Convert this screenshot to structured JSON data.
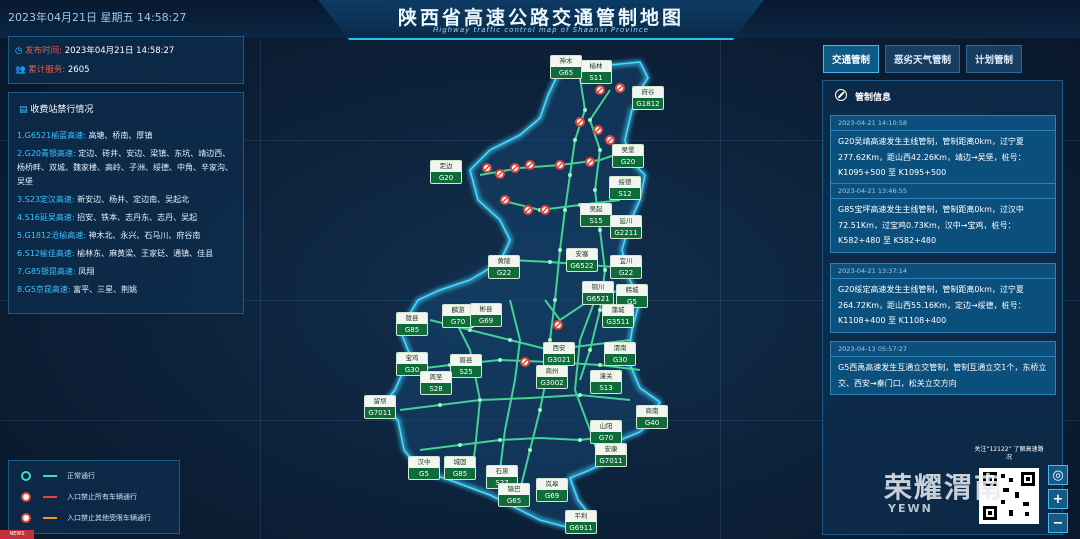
{
  "header": {
    "datetime": "2023年04月21日 星期五 14:58:27",
    "title": "陕西省高速公路交通管制地图",
    "subtitle": "Highway traffic control map of Shaanxi Province"
  },
  "info": {
    "publish_label": "发布时间:",
    "publish_value": "2023年04月21日 14:58:27",
    "served_label": "累计服务:",
    "served_value": "2605"
  },
  "toll": {
    "title": "收费站禁行情况",
    "rows": [
      {
        "road": "1.G6521榆蓝高速:",
        "stations": "高塘、桥南、厚镇"
      },
      {
        "road": "2.G20青银高速:",
        "stations": "定边、砖井、安边、梁镇、东坑、靖边西、杨桥畔、双城、魏家楼、高岭、子洲、绥德、中角、辛家沟、吴堡"
      },
      {
        "road": "3.S23定汉高速:",
        "stations": "新安边、杨井、定边南、吴起北"
      },
      {
        "road": "4.S16延吴高速:",
        "stations": "招安、铁本、志丹东、志丹、吴起"
      },
      {
        "road": "5.G1812沧榆高速:",
        "stations": "神木北、永兴、石马川、府谷南"
      },
      {
        "road": "6.S12榆佳高速:",
        "stations": "榆林东、麻黄梁、王家砭、通镇、佳县"
      },
      {
        "road": "7.G85银昆高速:",
        "stations": "凤翔"
      },
      {
        "road": "8.G5京昆高速:",
        "stations": "富平、三星、荆姚"
      }
    ]
  },
  "legend": [
    {
      "label": "正常通行",
      "icon": "normal-dot-icon",
      "color": "#37e0c0"
    },
    {
      "label": "入口禁止所有车辆通行",
      "icon": "no-entry-icon",
      "color": "#e0453c"
    },
    {
      "label": "入口禁止其他受限车辆通行",
      "icon": "no-entry-icon",
      "color": "#f09a2a"
    }
  ],
  "tabs": [
    "交通管制",
    "恶劣天气管制",
    "计划管制"
  ],
  "control": {
    "title": "管制信息",
    "items": [
      {
        "time": "2023-04-21 14:10:58",
        "text": "G20吴靖高速发生主线管制，管制距离0km，过宁夏277.62Km，距山西42.26Km，靖边→吴堡，桩号：K1095+500 至 K1095+500"
      },
      {
        "time": "2023-04-21 13:46:55",
        "text": "G85宝坪高速发生主线管制，管制距离0km，过汉中72.51Km，过宝鸡0.73Km，汉中→宝鸡，桩号：K582+480 至 K582+480"
      },
      {
        "time": "2023-04-21 13:37:14",
        "text": "G20绥定高速发生主线管制，管制距离0km，过宁夏264.72Km，距山西55.16Km，定边→绥德，桩号：K1108+400 至 K1108+400"
      },
      {
        "time": "2023-04-13 05:57:27",
        "text": "G5西禹高速发生互通立交管制，管制互通立交1个，东桥立交、西安→秦门口，松关立交方向"
      }
    ]
  },
  "shields": [
    {
      "name": "榆林",
      "code": "S11"
    },
    {
      "name": "神木",
      "code": "G65"
    },
    {
      "name": "府谷",
      "code": "G1812"
    },
    {
      "name": "吴堡",
      "code": "G20"
    },
    {
      "name": "绥德",
      "code": "S12"
    },
    {
      "name": "定边",
      "code": "G20"
    },
    {
      "name": "吴起",
      "code": "S15"
    },
    {
      "name": "延川",
      "code": "G2211"
    },
    {
      "name": "安塞",
      "code": "G6522"
    },
    {
      "name": "黄陵",
      "code": "G22"
    },
    {
      "name": "宜川",
      "code": "G22"
    },
    {
      "name": "韩城",
      "code": "G5"
    },
    {
      "name": "铜川",
      "code": "G6521"
    },
    {
      "name": "蒲城",
      "code": "G3511"
    },
    {
      "name": "陇县",
      "code": "G85"
    },
    {
      "name": "麟游",
      "code": "G70"
    },
    {
      "name": "彬县",
      "code": "G69"
    },
    {
      "name": "渭南",
      "code": "G30"
    },
    {
      "name": "西安",
      "code": "G3021"
    },
    {
      "name": "宝鸡",
      "code": "G30"
    },
    {
      "name": "眉县",
      "code": "S25"
    },
    {
      "name": "周至",
      "code": "S28"
    },
    {
      "name": "商州",
      "code": "G3002"
    },
    {
      "name": "潼关",
      "code": "S13"
    },
    {
      "name": "留坝",
      "code": "G7011"
    },
    {
      "name": "商南",
      "code": "G40"
    },
    {
      "name": "山阳",
      "code": "G70"
    },
    {
      "name": "安康",
      "code": "G7011"
    },
    {
      "name": "汉中",
      "code": "G5"
    },
    {
      "name": "城固",
      "code": "G85"
    },
    {
      "name": "石泉",
      "code": "S27"
    },
    {
      "name": "岚皋",
      "code": "G69"
    },
    {
      "name": "镇巴",
      "code": "G65"
    },
    {
      "name": "平利",
      "code": "G6911"
    }
  ],
  "qr_caption": "关注“12122”\n了解高速路况",
  "watermark": "荣耀渭南",
  "watermark_sub": "YEWN",
  "zoom": {
    "locate": "◎",
    "in": "+",
    "out": "−"
  },
  "corner_logo": "NEWS"
}
